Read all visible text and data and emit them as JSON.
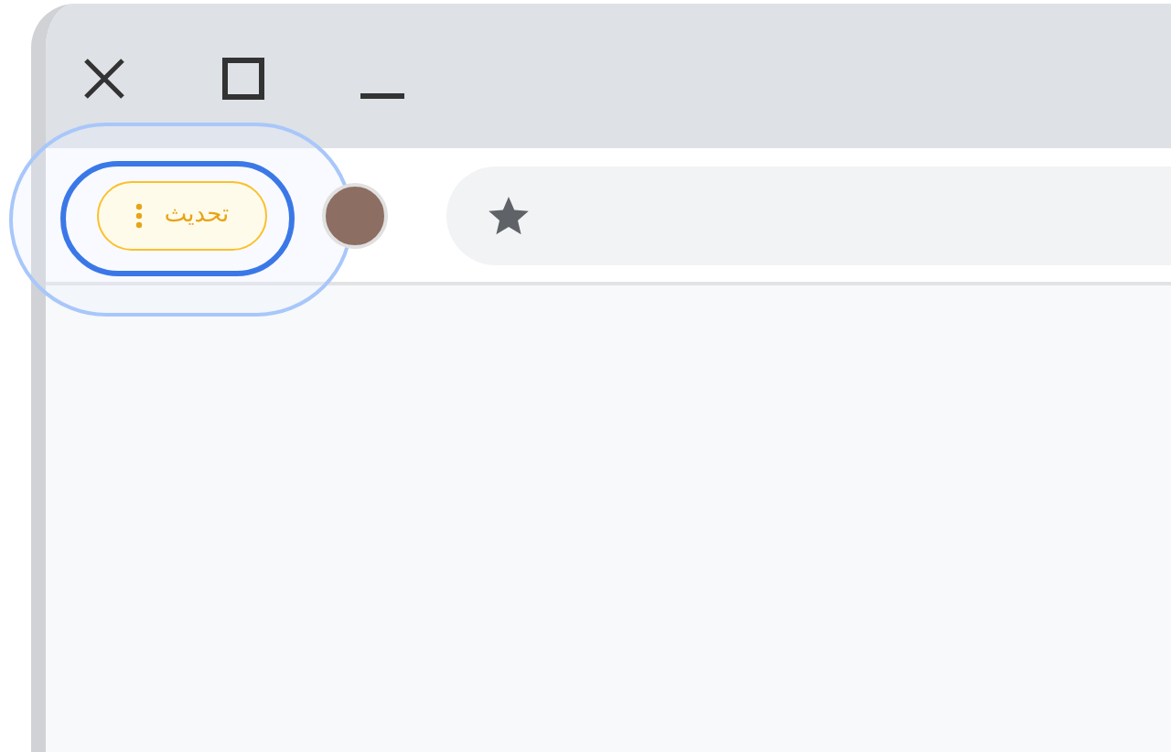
{
  "toolbar": {
    "update_button": {
      "label": "تحديث",
      "highlighted": true
    }
  }
}
